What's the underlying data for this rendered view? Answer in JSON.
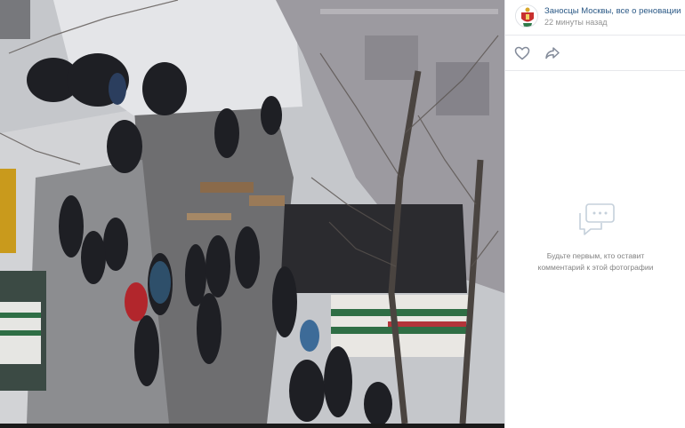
{
  "post": {
    "author_name": "Заносцы Москвы, все о реновации",
    "time": "22 минуты назад"
  },
  "photo": {
    "description_icon": "photo-viewer-image"
  },
  "actions": {
    "like_icon": "heart-icon",
    "share_icon": "share-arrow-icon"
  },
  "comments": {
    "empty_line1": "Будьте первым, кто оставит",
    "empty_line2": "комментарий к этой фотографии",
    "empty_icon": "comments-icon"
  },
  "colors": {
    "link": "#2a5885",
    "muted": "#939393",
    "icon": "#828a99",
    "empty_icon": "#c5d0db"
  }
}
